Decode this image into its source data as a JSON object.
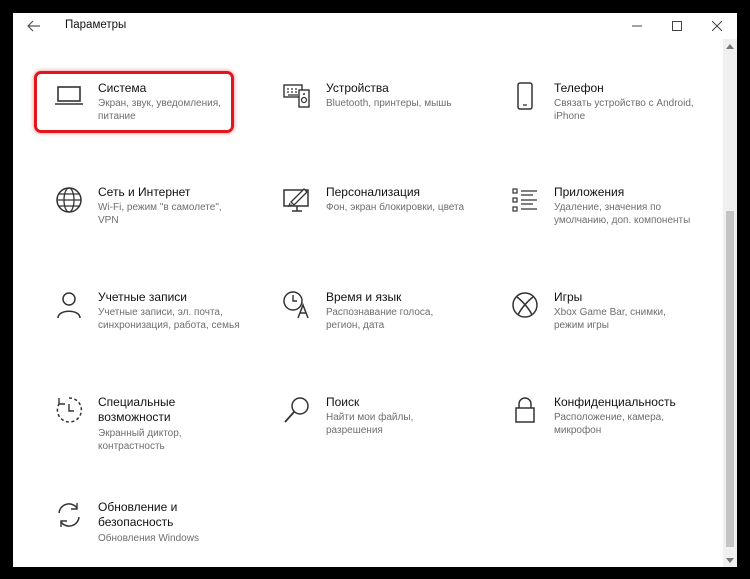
{
  "window": {
    "title": "Параметры"
  },
  "tiles": [
    {
      "title": "Система",
      "desc1": "Экран, звук, уведомления,",
      "desc2": "питание",
      "icon": "laptop-icon"
    },
    {
      "title": "Устройства",
      "desc1": "Bluetooth, принтеры, мышь",
      "desc2": "",
      "icon": "devices-icon"
    },
    {
      "title": "Телефон",
      "desc1": "Связать устройство с Android,",
      "desc2": "iPhone",
      "icon": "phone-icon"
    },
    {
      "title": "Сеть и Интернет",
      "desc1": "Wi-Fi, режим \"в самолете\",",
      "desc2": "VPN",
      "icon": "globe-icon"
    },
    {
      "title": "Персонализация",
      "desc1": "Фон, экран блокировки, цвета",
      "desc2": "",
      "icon": "personalization-icon"
    },
    {
      "title": "Приложения",
      "desc1": "Удаление, значения по",
      "desc2": "умолчанию, доп. компоненты",
      "icon": "apps-list-icon"
    },
    {
      "title": "Учетные записи",
      "desc1": "Учетные записи, эл. почта,",
      "desc2": "синхронизация, работа, семья",
      "icon": "person-icon"
    },
    {
      "title": "Время и язык",
      "desc1": "Распознавание голоса,",
      "desc2": "регион, дата",
      "icon": "time-language-icon"
    },
    {
      "title": "Игры",
      "desc1": "Xbox Game Bar, снимки,",
      "desc2": "режим игры",
      "icon": "xbox-icon"
    },
    {
      "title1": "Специальные",
      "title2": "возможности",
      "desc1": "Экранный диктор,",
      "desc2": "контрастность",
      "icon": "accessibility-icon"
    },
    {
      "title": "Поиск",
      "desc1": "Найти мои файлы,",
      "desc2": "разрешения",
      "icon": "search-icon"
    },
    {
      "title": "Конфиденциальность",
      "desc1": "Расположение, камера,",
      "desc2": "микрофон",
      "icon": "lock-icon"
    },
    {
      "title1": "Обновление и",
      "title2": "безопасность",
      "desc1": "Обновления Windows",
      "desc2": "",
      "icon": "sync-icon"
    }
  ],
  "colors": {
    "highlight": "#e0161c",
    "icon": "#333333",
    "secondary_text": "#6e6e6e"
  }
}
